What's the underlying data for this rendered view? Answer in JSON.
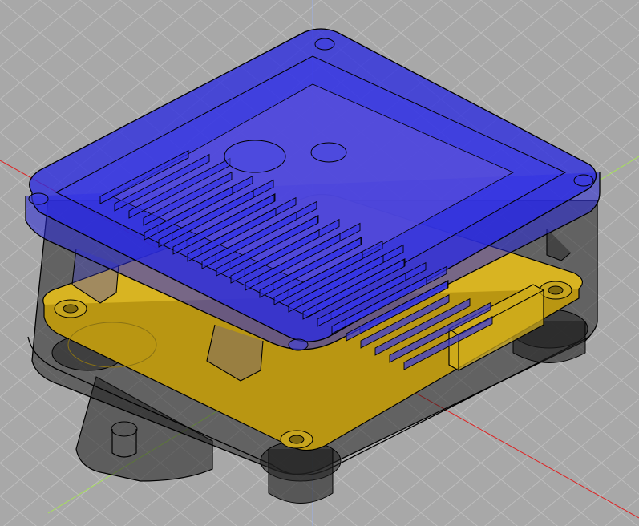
{
  "viewport": {
    "background": "#a8a8a8",
    "grid_color": "#bdbdbd",
    "grid_visible": true
  },
  "axes": {
    "x_color": "#e02020",
    "y_color": "#a6e05a",
    "z_color": "#9ab0e8"
  },
  "model": {
    "parts": [
      {
        "name": "lid",
        "color": "#2a2ad6",
        "transparent": true
      },
      {
        "name": "pcb-board",
        "color": "#d6b21e",
        "transparent": false
      },
      {
        "name": "enclosure-base",
        "color": "#2b2b2b",
        "transparent": true
      },
      {
        "name": "usb-connector",
        "color": "#d6b21e",
        "transparent": true
      },
      {
        "name": "mounting-flange",
        "color": "#2b2b2b",
        "transparent": true
      }
    ],
    "lid_vent_slots": 38,
    "mounting_holes": 4
  }
}
